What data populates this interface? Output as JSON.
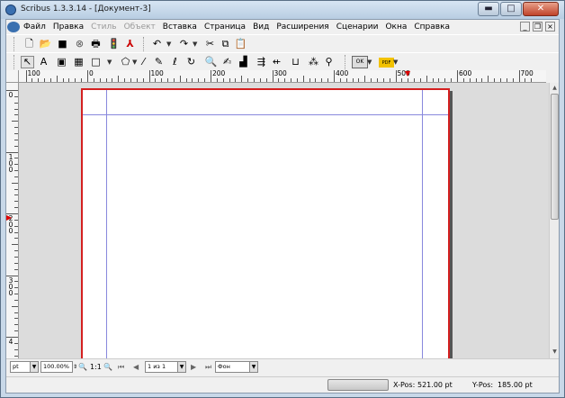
{
  "window": {
    "title": "Scribus 1.3.3.14 - [Документ-3]",
    "minimize_glyph": "▬",
    "maximize_glyph": "□",
    "close_glyph": "✕"
  },
  "menu": {
    "items": [
      {
        "label": "Файл",
        "enabled": true
      },
      {
        "label": "Правка",
        "enabled": true
      },
      {
        "label": "Стиль",
        "enabled": false
      },
      {
        "label": "Объект",
        "enabled": false
      },
      {
        "label": "Вставка",
        "enabled": true
      },
      {
        "label": "Страница",
        "enabled": true
      },
      {
        "label": "Вид",
        "enabled": true
      },
      {
        "label": "Расширения",
        "enabled": true
      },
      {
        "label": "Сценарии",
        "enabled": true
      },
      {
        "label": "Окна",
        "enabled": true
      },
      {
        "label": "Справка",
        "enabled": true
      }
    ]
  },
  "toolbar1": [
    {
      "name": "new-document-icon",
      "glyph": "🗋"
    },
    {
      "name": "open-folder-icon",
      "glyph": "📂"
    },
    {
      "name": "save-icon",
      "glyph": "■"
    },
    {
      "name": "close-document-icon",
      "glyph": "⊗"
    },
    {
      "name": "print-icon",
      "glyph": "🖶"
    },
    {
      "name": "preflight-verifier-icon",
      "glyph": "🚦"
    },
    {
      "name": "export-pdf-icon",
      "glyph": "⅄"
    },
    {
      "name": "undo-icon",
      "glyph": "↶"
    },
    {
      "name": "redo-icon",
      "glyph": "↷"
    },
    {
      "name": "cut-icon",
      "glyph": "✂"
    },
    {
      "name": "copy-icon",
      "glyph": "⧉"
    },
    {
      "name": "paste-icon",
      "glyph": "📋"
    }
  ],
  "toolbar2": [
    {
      "name": "select-tool-icon",
      "glyph": "↖"
    },
    {
      "name": "text-frame-icon",
      "glyph": "A"
    },
    {
      "name": "image-frame-icon",
      "glyph": "▣"
    },
    {
      "name": "table-icon",
      "glyph": "▦"
    },
    {
      "name": "shape-icon",
      "glyph": "□"
    },
    {
      "name": "polygon-icon",
      "glyph": "⬠"
    },
    {
      "name": "line-icon",
      "glyph": "⁄"
    },
    {
      "name": "bezier-icon",
      "glyph": "✎"
    },
    {
      "name": "freehand-icon",
      "glyph": "ℓ"
    },
    {
      "name": "rotate-icon",
      "glyph": "↻"
    },
    {
      "name": "zoom-icon",
      "glyph": "🔍"
    },
    {
      "name": "edit-contents-icon",
      "glyph": "✍"
    },
    {
      "name": "edit-text-icon",
      "glyph": "▟"
    },
    {
      "name": "link-frames-icon",
      "glyph": "⇶"
    },
    {
      "name": "unlink-frames-icon",
      "glyph": "⇷"
    },
    {
      "name": "measurements-icon",
      "glyph": "⊔"
    },
    {
      "name": "copy-properties-icon",
      "glyph": "⁂"
    },
    {
      "name": "eyedropper-icon",
      "glyph": "⚲"
    },
    {
      "name": "pdf-pushbutton-icon",
      "glyph": "OK"
    },
    {
      "name": "pdf-annotation-icon",
      "glyph": "PDF"
    }
  ],
  "ruler": {
    "h_labels": [
      "100",
      "0",
      "100",
      "200",
      "300",
      "400",
      "500",
      "600",
      "700"
    ],
    "v_labels": [
      "0",
      "100",
      "200",
      "300",
      "4"
    ]
  },
  "navigation": {
    "unit": "pt",
    "zoom": "100.00%",
    "zoom_reset_label": "1:1",
    "page": "1 из 1",
    "layer": "Фон"
  },
  "status": {
    "x_pos_label": "X-Pos:",
    "x_pos_value": "521.00 pt",
    "y_pos_label": "Y-Pos:",
    "y_pos_value": "185.00 pt"
  }
}
